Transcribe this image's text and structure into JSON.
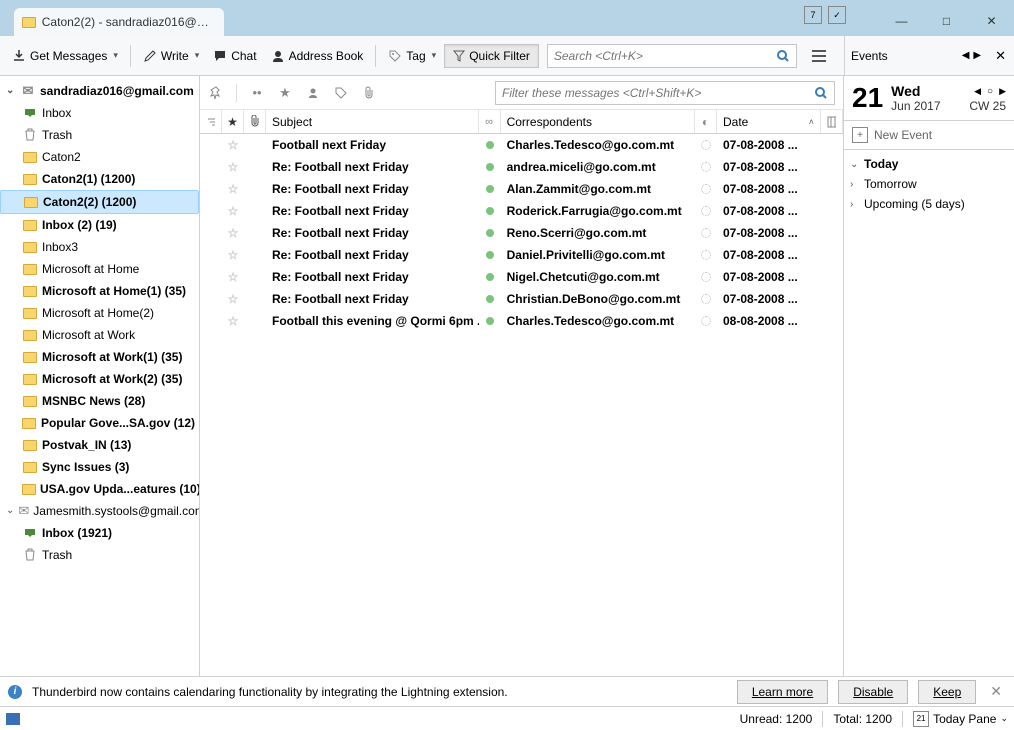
{
  "tab": {
    "title": "Caton2(2) -  sandradiaz016@g..."
  },
  "window_buttons": {
    "min": "—",
    "max": "□",
    "close": "✕"
  },
  "toolbar": {
    "get_messages": "Get Messages",
    "write": "Write",
    "chat": "Chat",
    "address_book": "Address Book",
    "tag": "Tag",
    "quick_filter": "Quick Filter",
    "search_placeholder": "Search <Ctrl+K>"
  },
  "folders": {
    "account1": {
      "name": "sandradiaz016@gmail.com",
      "items": [
        {
          "label": "Inbox",
          "type": "inbox"
        },
        {
          "label": "Trash",
          "type": "trash"
        },
        {
          "label": "Caton2",
          "type": "folder"
        },
        {
          "label": "Caton2(1) (1200)",
          "type": "folder",
          "bold": true
        },
        {
          "label": "Caton2(2) (1200)",
          "type": "folder",
          "bold": true,
          "selected": true
        },
        {
          "label": "Inbox (2) (19)",
          "type": "folder",
          "bold": true
        },
        {
          "label": "Inbox3",
          "type": "folder"
        },
        {
          "label": "Microsoft at Home",
          "type": "folder"
        },
        {
          "label": "Microsoft at Home(1) (35)",
          "type": "folder",
          "bold": true
        },
        {
          "label": "Microsoft at Home(2)",
          "type": "folder"
        },
        {
          "label": "Microsoft at Work",
          "type": "folder"
        },
        {
          "label": "Microsoft at Work(1) (35)",
          "type": "folder",
          "bold": true
        },
        {
          "label": "Microsoft at Work(2) (35)",
          "type": "folder",
          "bold": true
        },
        {
          "label": "MSNBC News (28)",
          "type": "folder",
          "bold": true
        },
        {
          "label": "Popular Gove...SA.gov (12)",
          "type": "folder",
          "bold": true
        },
        {
          "label": "Postvak_IN (13)",
          "type": "folder",
          "bold": true
        },
        {
          "label": "Sync Issues (3)",
          "type": "folder",
          "bold": true
        },
        {
          "label": "USA.gov Upda...eatures (10)",
          "type": "folder",
          "bold": true
        }
      ]
    },
    "account2": {
      "name": "Jamesmith.systools@gmail.com",
      "items": [
        {
          "label": "Inbox (1921)",
          "type": "inbox",
          "bold": true
        },
        {
          "label": "Trash",
          "type": "trash"
        }
      ]
    }
  },
  "msg_filter_placeholder": "Filter these messages <Ctrl+Shift+K>",
  "columns": {
    "subject": "Subject",
    "correspondents": "Correspondents",
    "date": "Date"
  },
  "messages": [
    {
      "subject": "Football next Friday",
      "from": "Charles.Tedesco@go.com.mt",
      "date": "07-08-2008 ..."
    },
    {
      "subject": "Re: Football next Friday",
      "from": "andrea.miceli@go.com.mt",
      "date": "07-08-2008 ..."
    },
    {
      "subject": "Re: Football next Friday",
      "from": "Alan.Zammit@go.com.mt",
      "date": "07-08-2008 ..."
    },
    {
      "subject": "Re: Football next Friday",
      "from": "Roderick.Farrugia@go.com.mt",
      "date": "07-08-2008 ..."
    },
    {
      "subject": "Re: Football next Friday",
      "from": "Reno.Scerri@go.com.mt",
      "date": "07-08-2008 ..."
    },
    {
      "subject": "Re: Football next Friday",
      "from": "Daniel.Privitelli@go.com.mt",
      "date": "07-08-2008 ..."
    },
    {
      "subject": "Re: Football next Friday",
      "from": "Nigel.Chetcuti@go.com.mt",
      "date": "07-08-2008 ..."
    },
    {
      "subject": "Re: Football next Friday",
      "from": "Christian.DeBono@go.com.mt",
      "date": "07-08-2008 ..."
    },
    {
      "subject": "Football this evening @ Qormi 6pm ...",
      "from": "Charles.Tedesco@go.com.mt",
      "date": "08-08-2008 ..."
    }
  ],
  "events_panel": {
    "title": "Events",
    "day_number": "21",
    "weekday": "Wed",
    "month_year": "Jun 2017",
    "cw": "CW 25",
    "new_event": "New Event",
    "sections": [
      {
        "label": "Today",
        "expanded": true
      },
      {
        "label": "Tomorrow",
        "expanded": false
      },
      {
        "label": "Upcoming (5 days)",
        "expanded": false
      }
    ]
  },
  "notification": {
    "text": "Thunderbird now contains calendaring functionality by integrating the Lightning extension.",
    "learn_more": "Learn more",
    "disable": "Disable",
    "keep": "Keep"
  },
  "status": {
    "unread": "Unread: 1200",
    "total": "Total: 1200",
    "today_pane": "Today Pane"
  }
}
